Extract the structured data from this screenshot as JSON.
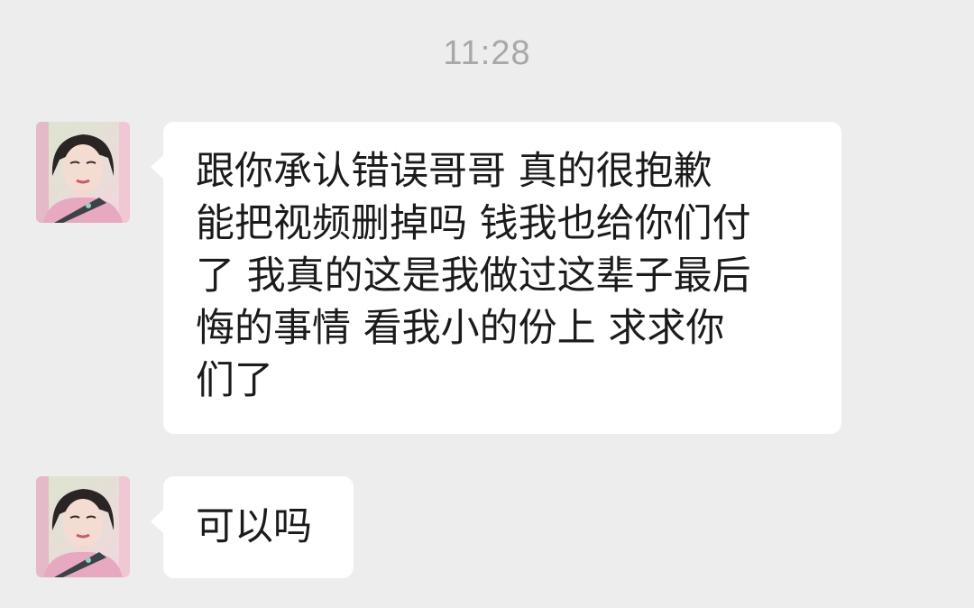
{
  "chat": {
    "timestamp": "11:28",
    "messages": [
      {
        "sender": "contact",
        "avatar_icon": "profile-photo-avatar",
        "lines": [
          "跟你承认错误哥哥 真的很抱歉",
          "能把视频删掉吗 钱我也给你们付",
          "了 我真的这是我做过这辈子最后",
          "悔的事情 看我小的份上 求求你",
          "们了"
        ]
      },
      {
        "sender": "contact",
        "avatar_icon": "profile-photo-avatar",
        "lines": [
          "可以吗"
        ]
      }
    ]
  },
  "colors": {
    "background": "#ededed",
    "bubble": "#ffffff",
    "timestamp_text": "#a8a8a8",
    "message_text": "#1b1b1b"
  }
}
